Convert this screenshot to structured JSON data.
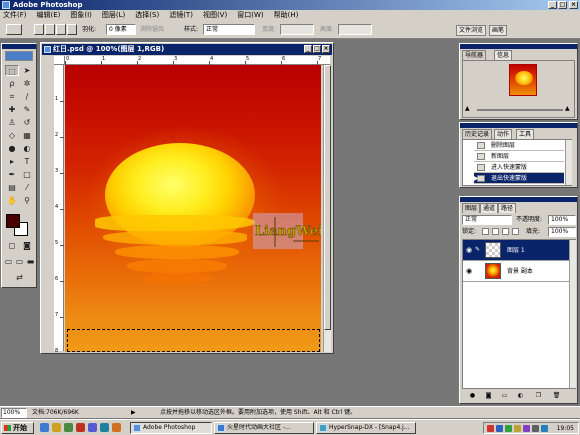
{
  "app": {
    "title": "Adobe Photoshop",
    "window_controls": [
      "_",
      "□",
      "×"
    ]
  },
  "menu": [
    "文件(F)",
    "编辑(E)",
    "图象(I)",
    "图层(L)",
    "选择(S)",
    "滤镜(T)",
    "视图(V)",
    "窗口(W)",
    "帮助(H)"
  ],
  "options": {
    "feather_label": "羽化:",
    "feather_value": "0 像素",
    "antialias_label": "消除锯齿",
    "style_label": "样式:",
    "style_value": "正常",
    "width_label": "宽度:",
    "height_label": "高度:",
    "palette_tabs": [
      "文件浏览",
      "画笔"
    ]
  },
  "document": {
    "title": "红日.psd @ 100%(图层 1,RGB)",
    "ruler_h": [
      "0",
      "1",
      "2",
      "3",
      "4",
      "5",
      "6",
      "7"
    ],
    "ruler_v": [
      "1",
      "2",
      "3",
      "4",
      "5",
      "6",
      "7",
      "8"
    ],
    "watermark": "LiangWei"
  },
  "navigator": {
    "tabs": [
      "导航器",
      "信息"
    ]
  },
  "history": {
    "tabs": [
      "历史记录",
      "动作",
      "工具"
    ],
    "items": [
      {
        "label": "删除图层",
        "active": false
      },
      {
        "label": "新图层",
        "active": false
      },
      {
        "label": "进入快速蒙版",
        "active": false
      },
      {
        "label": "退出快速蒙版",
        "active": true
      }
    ]
  },
  "layers": {
    "tabs": [
      "图层",
      "通道",
      "路径"
    ],
    "blend_mode": "正常",
    "opacity_label": "不透明度:",
    "opacity_value": "100%",
    "lock_label": "锁定:",
    "fill_label": "填充:",
    "fill_value": "100%",
    "items": [
      {
        "name": "图层 1",
        "active": true
      },
      {
        "name": "背景 副本",
        "active": false
      }
    ]
  },
  "statusbar": {
    "zoom": "100%",
    "doc": "文档:706K/696K",
    "hint": "点按并拖移以移动选区外框。要用附加选项，使用 Shift、Alt 和 Ctrl 键。"
  },
  "taskbar": {
    "start": "开始",
    "tasks": [
      {
        "label": "Adobe Photoshop",
        "pressed": true
      },
      {
        "label": "火星时代动画大社区 -...",
        "pressed": false
      },
      {
        "label": "HyperSnap-DX - [Snap4.j...",
        "pressed": false
      }
    ],
    "clock": "19:05"
  },
  "colors": {
    "titlebar": "#0a246a",
    "chrome": "#d4d0c8",
    "workspace": "#777777",
    "foreground_swatch": "#4a0000",
    "background_swatch": "#ffffff"
  }
}
